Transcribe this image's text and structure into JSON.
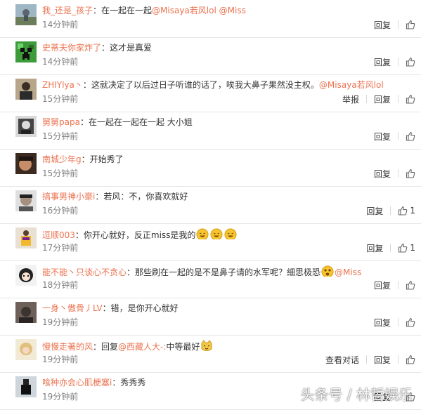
{
  "comments": [
    {
      "user": "我_还是_孩子",
      "text": "：在一起在一起",
      "mentions": [
        "@Misaya若风lol",
        "@Miss"
      ],
      "time": "14分钟前",
      "report": "",
      "view_chat": "",
      "reply": "回复",
      "likes": "",
      "avatar": "landscape"
    },
    {
      "user": "史蒂夫你家炸了",
      "text": "：这才是真爱",
      "mentions": [],
      "time": "14分钟前",
      "report": "",
      "view_chat": "",
      "reply": "回复",
      "likes": "",
      "avatar": "creeper"
    },
    {
      "user": "ZHIYlya丶",
      "text": "：这就决定了以后过日子听谁的话了，唉我大鼻子果然没主权。",
      "mentions": [
        "@Misaya若风lol"
      ],
      "time": "15分钟前",
      "report": "举报",
      "view_chat": "",
      "reply": "回复",
      "likes": "",
      "avatar": "person-dark"
    },
    {
      "user": "舅舅papa",
      "text": "：在一起在一起在一起 大小姐",
      "mentions": [],
      "time": "15分钟前",
      "report": "",
      "view_chat": "",
      "reply": "回复",
      "likes": "",
      "avatar": "bw"
    },
    {
      "user": "南城少年g",
      "text": "：开始秀了",
      "mentions": [],
      "time": "15分钟前",
      "report": "",
      "view_chat": "",
      "reply": "回复",
      "likes": "",
      "avatar": "face-brown"
    },
    {
      "user": "搞事男神小豪i",
      "text": "：若风：不，你喜欢就好",
      "mentions": [],
      "time": "16分钟前",
      "report": "",
      "view_chat": "",
      "reply": "回复",
      "likes": "1",
      "avatar": "face-gray"
    },
    {
      "user": "逗顺003",
      "text": "：你开心就好，反正miss是我的",
      "mentions": [],
      "emojis": [
        "laugh",
        "laugh",
        "laugh"
      ],
      "time": "17分钟前",
      "report": "",
      "view_chat": "",
      "reply": "回复",
      "likes": "1",
      "avatar": "jersey"
    },
    {
      "user": "能不能丶只谈心不贪心",
      "text": "：那些刷在一起的是不是鼻子请的水军呢？細思极恐",
      "mentions": [
        "@Miss"
      ],
      "emoji_before_mention": "shock",
      "time": "18分钟前",
      "report": "",
      "view_chat": "",
      "reply": "回复",
      "likes": "",
      "avatar": "anime"
    },
    {
      "user": "一身丶傲骨丿LV",
      "text": "：错，是你开心就好",
      "mentions": [],
      "time": "19分钟前",
      "report": "",
      "view_chat": "",
      "reply": "回复",
      "likes": "",
      "avatar": "dark"
    },
    {
      "user": "慢慢走著的风",
      "text": "：回复",
      "mentions": [
        "@西藏人大-:"
      ],
      "text_after": "中等最好",
      "emojis_after": [
        "cat"
      ],
      "time": "19分钟前",
      "report": "",
      "view_chat": "查看对话",
      "reply": "回复",
      "likes": "",
      "avatar": "blonde"
    },
    {
      "user": "喰种亦会心肌梗塞i",
      "text": "：秀秀秀",
      "mentions": [],
      "time": "19分钟前",
      "report": "",
      "view_chat": "",
      "reply": "回复",
      "likes": "",
      "avatar": "figure"
    }
  ],
  "watermark": "头条号 / 林哲娱乐",
  "colors": {
    "link": "#eb7350",
    "text": "#333333",
    "time": "#808080",
    "divider": "#e6e6e6"
  },
  "icons": {
    "like": "thumbs-up-icon"
  }
}
